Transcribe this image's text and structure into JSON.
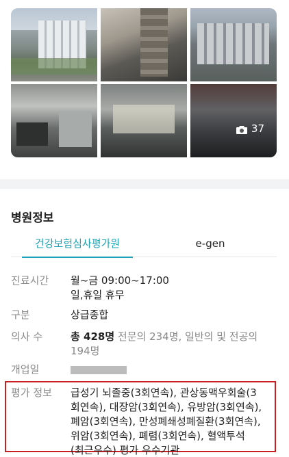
{
  "gallery": {
    "photo_count": "37",
    "photos": [
      "photo-1",
      "photo-2",
      "photo-3",
      "photo-4",
      "photo-5",
      "photo-6"
    ],
    "camera_icon": "camera-icon"
  },
  "section": {
    "title": "병원정보"
  },
  "tabs": [
    {
      "label": "건강보험심사평가원",
      "active": true
    },
    {
      "label": "e-gen",
      "active": false
    }
  ],
  "info": {
    "hours": {
      "label": "진료시간",
      "line1": "월~금 09:00~17:00",
      "line2": "일,휴일 휴무"
    },
    "category": {
      "label": "구분",
      "value": "상급종합"
    },
    "doctors": {
      "label": "의사 수",
      "total": "총 428명",
      "detail": " 전문의 234명, 일반의 및 전공의",
      "detail2": "194명"
    },
    "opened": {
      "label": "개업일"
    },
    "evaluation": {
      "label": "평가 정보",
      "lines": [
        "급성기 뇌졸중(3회연속), 관상동맥우회술(3",
        "회연속), 대장암(3회연속), 유방암(3회연속),",
        "폐암(3회연속), 만성폐쇄성폐질환(3회연속),",
        "위암(3회연속), 폐렴(3회연속), 혈액투석",
        "(최근우수) 평가 우수기관"
      ]
    }
  },
  "colors": {
    "accent": "#1aa3b6",
    "highlight_border": "#c82020"
  }
}
